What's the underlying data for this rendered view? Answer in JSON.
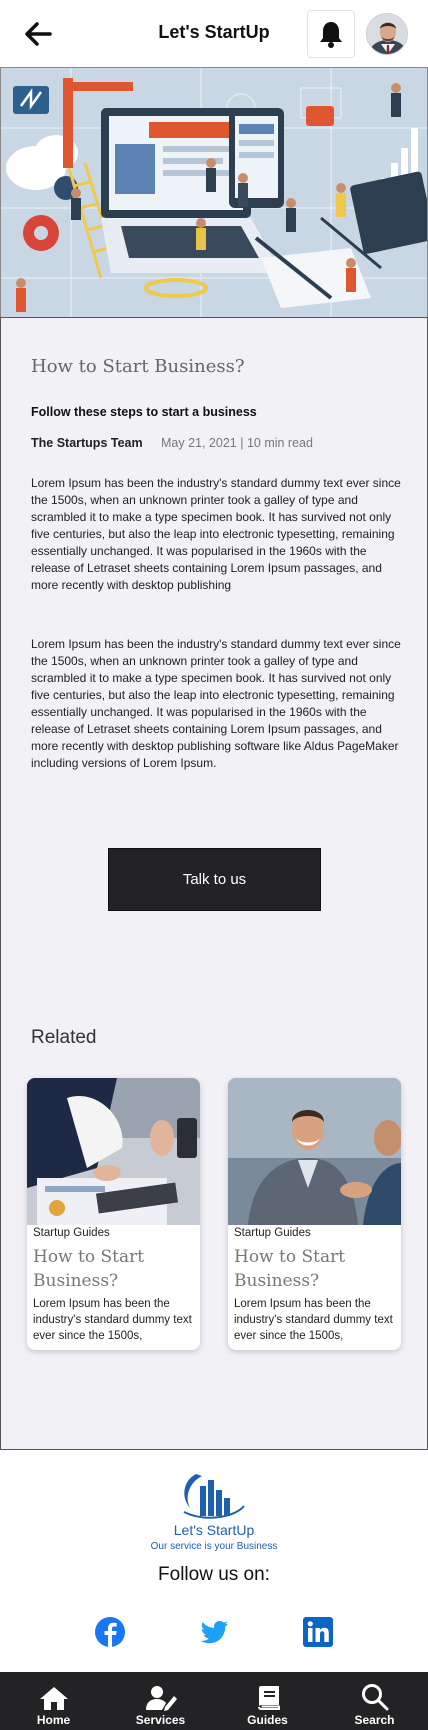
{
  "header": {
    "title": "Let's StartUp",
    "back_icon": "arrow-left-icon",
    "notification_icon": "bell-icon"
  },
  "article": {
    "title": "How to Start Business?",
    "subtitle": "Follow these steps to start a business",
    "author": "The Startups Team",
    "meta": "May 21, 2021 | 10 min read",
    "paragraphs": [
      "Lorem Ipsum has been the industry's standard dummy text ever since the 1500s, when an unknown printer took a galley of type and scrambled it to make a type specimen book. It has survived not only five centuries, but also the leap into electronic typesetting, remaining essentially unchanged. It was popularised in the 1960s with the release of Letraset sheets containing Lorem Ipsum passages, and more recently with desktop publishing",
      "Lorem Ipsum has been the industry's standard dummy text ever since the 1500s, when an unknown printer took a galley of type and scrambled it to make a type specimen book. It has survived not only five centuries, but also the leap into electronic typesetting, remaining essentially unchanged. It was popularised in the 1960s with the release of Letraset sheets containing Lorem Ipsum passages, and more recently with desktop publishing software like Aldus PageMaker including versions of Lorem Ipsum."
    ],
    "cta_label": "Talk to us"
  },
  "related": {
    "title": "Related",
    "cards": [
      {
        "category": "Startup Guides",
        "title": "How to Start Business?",
        "text": "Lorem Ipsum has been the industry's standard dummy text ever since the 1500s,"
      },
      {
        "category": "Startup Guides",
        "title": "How to Start Business?",
        "text": "Lorem Ipsum has been the industry's standard dummy text ever since the 1500s,"
      }
    ]
  },
  "footer": {
    "brand": "Let's StartUp",
    "slogan": "Our service is your Business",
    "follow_label": "Follow us on:",
    "social": [
      "facebook-icon",
      "twitter-icon",
      "linkedin-icon"
    ]
  },
  "bottom_nav": {
    "items": [
      {
        "label": "Home",
        "icon": "home-icon"
      },
      {
        "label": "Services",
        "icon": "services-icon"
      },
      {
        "label": "Guides",
        "icon": "book-icon"
      },
      {
        "label": "Search",
        "icon": "search-icon"
      }
    ]
  },
  "colors": {
    "nav_bg": "#232326",
    "article_bg": "#f1f1f6",
    "brand_blue": "#1f5fb0",
    "facebook": "#1877f2",
    "twitter": "#1da1f2",
    "linkedin": "#0a66c2"
  }
}
